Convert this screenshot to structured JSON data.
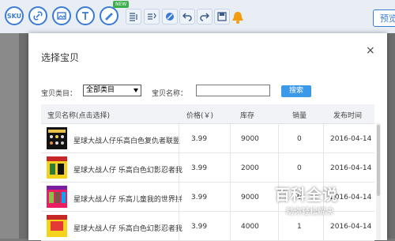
{
  "toolbar": {
    "sku_label": "SKU",
    "new_badge": "NEW",
    "preview_label": "预览"
  },
  "modal": {
    "title": "选择宝贝",
    "close": "×",
    "filter": {
      "category_label": "宝贝类目：",
      "category_value": "全部类目",
      "name_label": "宝贝名称：",
      "name_value": "",
      "search_label": "搜索"
    },
    "table": {
      "headers": [
        "宝贝名称(点击选择)",
        "价格(￥)",
        "库存",
        "销量",
        "发布时间"
      ],
      "rows": [
        {
          "name": "星球大战人仔乐高白色复仇者联盟",
          "price": "3.99",
          "stock": "9000",
          "sales": "0",
          "date": "2016-04-14"
        },
        {
          "name": "星球大战人仔 乐高白色幻影忍者我",
          "price": "3.99",
          "stock": "2000",
          "sales": "0",
          "date": "2016-04-14"
        },
        {
          "name": "星球大战人仔 乐高儿童我的世界拼",
          "price": "3.99",
          "stock": "9000",
          "sales": "0",
          "date": "2016-04-14"
        },
        {
          "name": "星球大战人仔 乐高白色幻影忍者我",
          "price": "3.99",
          "stock": "4000",
          "sales": "1",
          "date": "2016-04-14"
        }
      ]
    }
  },
  "watermark": {
    "title": "百科全说",
    "subtitle": "助你轻松解决"
  },
  "colors": {
    "accent": "#3a7bd5",
    "search_button": "#3a9ae8",
    "bell": "#f39c12",
    "new_badge": "#3ab04a"
  }
}
